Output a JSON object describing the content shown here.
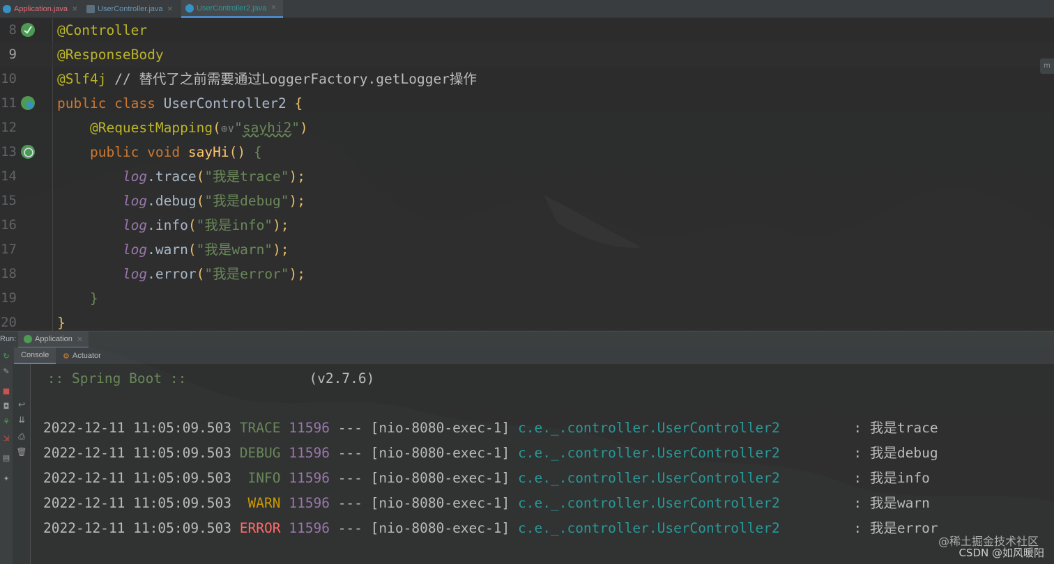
{
  "tabs": [
    {
      "label": "Application.java",
      "color": "#e06c75"
    },
    {
      "label": "UserController.java",
      "color": "#6897bb"
    },
    {
      "label": "UserController2.java",
      "color": "#299999"
    }
  ],
  "editor": {
    "lines": [
      {
        "num": "8"
      },
      {
        "num": "9"
      },
      {
        "num": "10"
      },
      {
        "num": "11"
      },
      {
        "num": "12"
      },
      {
        "num": "13"
      },
      {
        "num": "14"
      },
      {
        "num": "15"
      },
      {
        "num": "16"
      },
      {
        "num": "17"
      },
      {
        "num": "18"
      },
      {
        "num": "19"
      },
      {
        "num": "20"
      }
    ],
    "code": {
      "controller_ann": "@Controller",
      "responsebody_ann": "@ResponseBody",
      "slf4j_ann": "@Slf4j",
      "comment": "// 替代了之前需要通过LoggerFactory.getLogger操作",
      "kw_public": "public",
      "kw_class": "class",
      "class_name": "UserController2",
      "brace_open": "{",
      "mapping_ann": "@RequestMapping",
      "paren_open": "(",
      "mapping_hint": "⊕∨",
      "mapping_quote_open": "\"",
      "mapping_path": "sayhi2",
      "mapping_quote_close": "\"",
      "paren_close": ")",
      "kw_void": "void",
      "method_name": "sayHi",
      "method_parens": "()",
      "log_var": "log",
      "calls": [
        {
          "method": ".trace",
          "arg": "\"我是trace\""
        },
        {
          "method": ".debug",
          "arg": "\"我是debug\""
        },
        {
          "method": ".info",
          "arg": "\"我是info\""
        },
        {
          "method": ".warn",
          "arg": "\"我是warn\""
        },
        {
          "method": ".error",
          "arg": "\"我是error\""
        }
      ],
      "call_open": "(",
      "call_close": ");",
      "brace_close": "}"
    },
    "bookmark_icon": "m"
  },
  "run": {
    "label": "Run:",
    "tab_label": "Application",
    "subtabs": [
      "Console",
      "Actuator"
    ]
  },
  "console": {
    "banner_left": " :: Spring Boot ::",
    "banner_version": "(v2.7.6)",
    "logs": [
      {
        "ts": "2022-12-11 11:05:09.503",
        "level": "TRACE",
        "pid": "11596",
        "sep": "---",
        "thread": "[nio-8080-exec-1]",
        "logger": "c.e._.controller.UserController2",
        "colon": ":",
        "msg": "我是trace"
      },
      {
        "ts": "2022-12-11 11:05:09.503",
        "level": "DEBUG",
        "pid": "11596",
        "sep": "---",
        "thread": "[nio-8080-exec-1]",
        "logger": "c.e._.controller.UserController2",
        "colon": ":",
        "msg": "我是debug"
      },
      {
        "ts": "2022-12-11 11:05:09.503",
        "level": " INFO",
        "pid": "11596",
        "sep": "---",
        "thread": "[nio-8080-exec-1]",
        "logger": "c.e._.controller.UserController2",
        "colon": ":",
        "msg": "我是info"
      },
      {
        "ts": "2022-12-11 11:05:09.503",
        "level": " WARN",
        "pid": "11596",
        "sep": "---",
        "thread": "[nio-8080-exec-1]",
        "logger": "c.e._.controller.UserController2",
        "colon": ":",
        "msg": "我是warn"
      },
      {
        "ts": "2022-12-11 11:05:09.503",
        "level": "ERROR",
        "pid": "11596",
        "sep": "---",
        "thread": "[nio-8080-exec-1]",
        "logger": "c.e._.controller.UserController2",
        "colon": ":",
        "msg": "我是error"
      }
    ]
  },
  "watermark": {
    "line1": "@稀土掘金技术社区",
    "line2": "CSDN @如风暖阳"
  }
}
